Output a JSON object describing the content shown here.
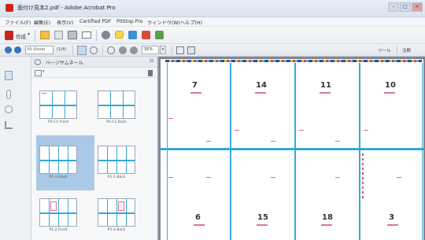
{
  "window": {
    "title": "面付け見本2.pdf - Adobe Acrobat Pro",
    "buttons": [
      "–",
      "□",
      "×"
    ]
  },
  "menu": [
    "ファイル(F)",
    "編集(E)",
    "表示(V)",
    "Certified PDF",
    "PitStop Pro",
    "ウィンドウ(W)",
    "ヘルプ(H)"
  ],
  "toolbar": {
    "create_label": "作成",
    "tools": [
      "open-folder",
      "save",
      "print",
      "email",
      "settings",
      "comment",
      "tag",
      "pdf",
      "doc"
    ]
  },
  "nav": {
    "page_field": "P1 (Front)",
    "page_count": "(1/4)",
    "zoom": "35%",
    "tools_label": "ツール",
    "comment_label": "注釈"
  },
  "panel": {
    "title": "ページサムネール",
    "thumbnails": [
      {
        "caption": "P1-C1 Front"
      },
      {
        "caption": "P1-C1 Back"
      },
      {
        "caption": "P1-1 Front"
      },
      {
        "caption": "P1-1 Back"
      },
      {
        "caption": "P1-2 Front"
      },
      {
        "caption": "P1-2 Back"
      }
    ]
  },
  "document": {
    "top_row": [
      "7",
      "14",
      "11",
      "10"
    ],
    "bottom_row": [
      "6",
      "15",
      "18",
      "3"
    ]
  },
  "colors": {
    "accent_blue": "#35a8d8",
    "selection": "#a9c9e6",
    "mark_pink": "#e06c8c"
  }
}
